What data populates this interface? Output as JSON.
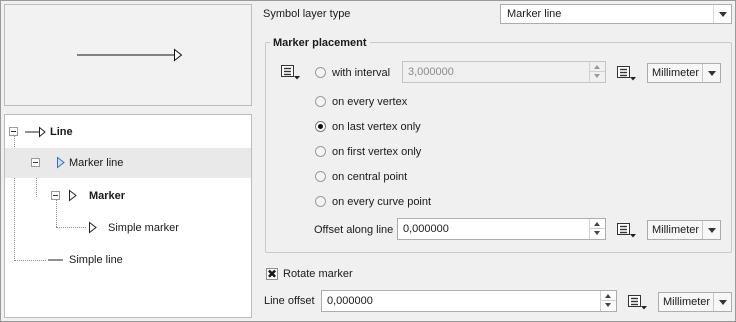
{
  "tree": {
    "items": [
      {
        "label": "Line",
        "bold": true,
        "icon": "line-icon"
      },
      {
        "label": "Marker line",
        "bold": false,
        "icon": "marker-line-icon",
        "selected": true
      },
      {
        "label": "Marker",
        "bold": true,
        "icon": "marker-icon"
      },
      {
        "label": "Simple marker",
        "bold": false,
        "icon": "simple-marker-icon"
      },
      {
        "label": "Simple line",
        "bold": false,
        "icon": "simple-line-icon"
      }
    ]
  },
  "symbol_layer_type": {
    "label": "Symbol layer type",
    "value": "Marker line"
  },
  "marker_placement": {
    "title": "Marker placement",
    "interval": {
      "label": "with interval",
      "value": "3,000000",
      "unit": "Millimeter",
      "enabled": false
    },
    "options": [
      {
        "label": "on every vertex",
        "checked": false
      },
      {
        "label": "on last vertex only",
        "checked": true
      },
      {
        "label": "on first vertex only",
        "checked": false
      },
      {
        "label": "on central point",
        "checked": false
      },
      {
        "label": "on every curve point",
        "checked": false
      }
    ],
    "offset_along_line": {
      "label": "Offset along line",
      "value": "0,000000",
      "unit": "Millimeter"
    }
  },
  "rotate_marker": {
    "label": "Rotate marker",
    "checked": true,
    "mark": "✖"
  },
  "line_offset": {
    "label": "Line offset",
    "value": "0,000000",
    "unit": "Millimeter"
  },
  "icons": {
    "data_defined": "data-defined-override-icon",
    "dropdown": "chevron-down-icon"
  },
  "colors": {
    "window_bg": "#f0f0f0",
    "selection_bg": "#e9e9e9",
    "tree_icon_blue": "#3d6fb6"
  }
}
